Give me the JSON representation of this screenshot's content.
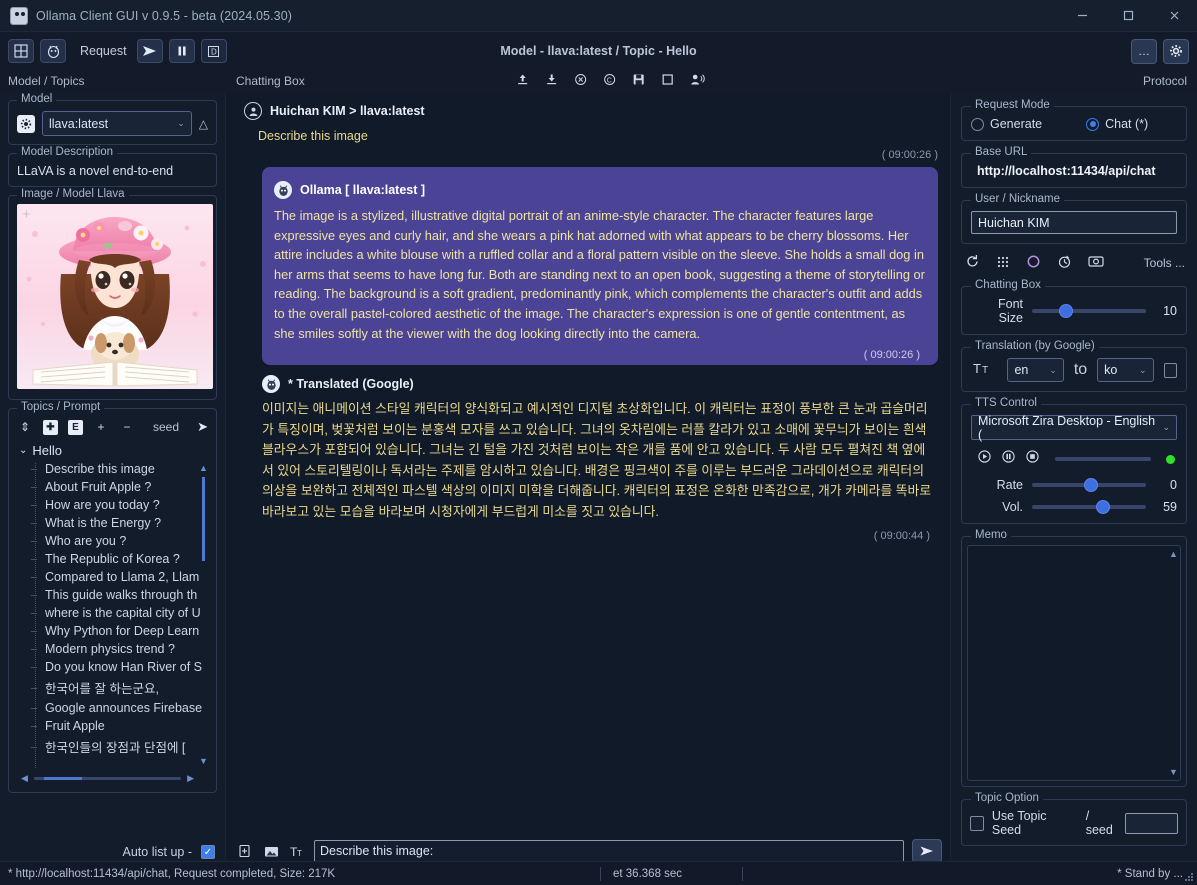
{
  "window": {
    "title": "Ollama Client GUI v 0.9.5 - beta (2024.05.30)",
    "app_icon": "ollama-logo-icon",
    "minimize": "–",
    "maximize": "□",
    "close": "✕"
  },
  "toolbar": {
    "grid_button": "grid-icon",
    "llama_button": "llama-icon",
    "request_label": "Request",
    "send_button": "send-icon",
    "pause_button": "pause-icon",
    "debug_button": "D",
    "center_title": "Model - llava:latest / Topic - Hello",
    "more_button": "…",
    "settings_button": "gear-icon"
  },
  "section_bar": {
    "left_title": "Model / Topics",
    "center_title": "Chatting Box",
    "right_title": "Protocol",
    "center_icons": [
      "upload-icon",
      "download-icon",
      "clear-icon",
      "copy-icon",
      "save-icon",
      "window-icon",
      "speak-icon"
    ]
  },
  "left": {
    "model_group": {
      "title": "Model",
      "selected": "llava:latest",
      "icon": "settings-chip-icon",
      "chevron": "⌄",
      "refresh_icon": "△"
    },
    "description_group": {
      "title": "Model Description",
      "text": "LLaVA is a novel end-to-end"
    },
    "image_group": {
      "title": "Image / Model Llava",
      "plus_overlay": "+"
    },
    "topics_group": {
      "title": "Topics / Prompt",
      "tools": [
        "sort-icon",
        "add-topic-icon",
        "edit-topic-icon",
        "plus-icon",
        "minus-icon"
      ],
      "seed_label": "seed",
      "send_icon": "send-icon",
      "root": "Hello",
      "items": [
        "Describe this image",
        "About Fruit Apple ?",
        "How are you today ?",
        "What is the Energy ?",
        "Who are you ?",
        "The Republic of Korea ?",
        "Compared to Llama 2, Llam",
        "This guide walks through th",
        "where is the capital city of U",
        "Why Python for Deep Learn",
        "Modern physics trend ?",
        "Do you know Han River of S",
        "한국어를 잘 하는군요,",
        "Google announces Firebase",
        "Fruit Apple",
        "한국인들의 장점과 단점에 ["
      ],
      "selected_index": 0
    },
    "auto_list": {
      "label": "Auto list up  -",
      "checked": true
    }
  },
  "chat": {
    "user_message": {
      "avatar": "user-avatar-icon",
      "header": "Huichan KIM  > llava:latest",
      "text": "Describe this image",
      "timestamp": "( 09:00:26 )"
    },
    "assistant_message": {
      "avatar": "ollama-avatar-icon",
      "header": "Ollama [ llava:latest ]",
      "text": "The image is a stylized, illustrative digital portrait of an anime-style character. The character features large expressive eyes and curly hair, and she wears a pink hat adorned with what appears to be cherry blossoms. Her attire includes a white blouse with a ruffled collar and a floral pattern visible on the sleeve. She holds a small dog in her arms that seems to have long fur. Both are standing next to an open book, suggesting a theme of storytelling or reading. The background is a soft gradient, predominantly pink, which complements the character's outfit and adds to the overall pastel-colored aesthetic of the image. The character's expression is one of gentle contentment, as she smiles softly at the viewer with the dog looking directly into the camera.",
      "timestamp": "( 09:00:26 )",
      "bubble_color": "#4b4496"
    },
    "translated_message": {
      "avatar": "ollama-avatar-icon",
      "header": "* Translated (Google)",
      "text": "이미지는 애니메이션 스타일 캐릭터의 양식화되고 예시적인 디지털 초상화입니다. 이 캐릭터는 표정이 풍부한 큰 눈과 곱슬머리가 특징이며, 벚꽃처럼 보이는 분홍색 모자를 쓰고 있습니다. 그녀의 옷차림에는 러플 칼라가 있고 소매에 꽃무늬가 보이는 흰색 블라우스가 포함되어 있습니다. 그녀는 긴 털을 가진 것처럼 보이는 작은 개를 품에 안고 있습니다. 두 사람 모두 펼쳐진 책 옆에 서 있어 스토리텔링이나 독서라는 주제를 암시하고 있습니다. 배경은 핑크색이 주를 이루는 부드러운 그라데이션으로 캐릭터의 의상을 보완하고 전체적인 파스텔 색상의 이미지 미학을 더해줍니다. 캐릭터의 표정은 온화한 만족감으로, 개가 카메라를 똑바로 바라보고 있는 모습을 바라보며 시청자에게 부드럽게 미소를 짓고 있습니다.",
      "timestamp": "( 09:00:44 )"
    },
    "input": {
      "value": "Describe this image:",
      "placeholder": "",
      "attach_icon": "attach-icon",
      "image_icon": "image-icon",
      "font_icon": "font-size-icon",
      "send_icon": "send-icon"
    }
  },
  "right": {
    "request_mode": {
      "title": "Request Mode",
      "option_generate": "Generate",
      "option_chat": "Chat (*)",
      "selected": "chat",
      "accent": "#3d7eeb"
    },
    "base_url": {
      "title": "Base URL",
      "value": "http://localhost:11434/api/chat"
    },
    "user_nickname": {
      "title": "User / Nickname",
      "value": "Huichan KIM"
    },
    "action_icons": [
      "refresh-icon",
      "grid-icon",
      "circle-icon",
      "timer-icon",
      "monitor-icon"
    ],
    "tools_label": "Tools ...",
    "chatting_box": {
      "title": "Chatting Box",
      "font_size_label": "Font Size",
      "font_size_value": "10",
      "slider_percent": 26
    },
    "translation": {
      "title": "Translation (by Google)",
      "icon": "translate-icon",
      "from": "en",
      "to_label": "to",
      "to": "ko",
      "enabled": false
    },
    "tts": {
      "title": "TTS Control",
      "voice": "Microsoft Zira Desktop - English (",
      "play_icon": "play-icon",
      "pause_icon": "pause-icon",
      "stop_icon": "stop-icon",
      "status_color": "#2fe02f",
      "rate_label": "Rate",
      "rate_value": "0",
      "rate_percent": 48,
      "vol_label": "Vol.",
      "vol_value": "59",
      "vol_percent": 58
    },
    "memo": {
      "title": "Memo",
      "value": ""
    },
    "topic_option": {
      "title": "Topic Option",
      "use_topic_seed": "Use Topic Seed",
      "checked": false,
      "seed_label": "/ seed",
      "seed_value": ""
    }
  },
  "status_bar": {
    "left": "* http://localhost:11434/api/chat, Request completed, Size: 217K",
    "middle": "et 36.368 sec",
    "right": "* Stand by ..."
  }
}
